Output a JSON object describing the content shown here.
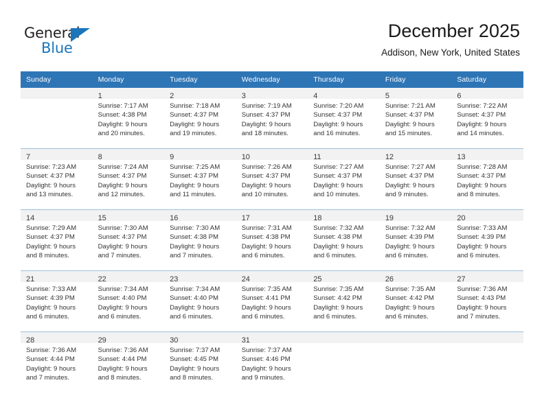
{
  "brand": {
    "name_part1": "General",
    "name_part2": "Blue",
    "accent_color": "#1b75bb"
  },
  "header": {
    "title": "December 2025",
    "subtitle": "Addison, New York, United States"
  },
  "theme": {
    "header_row_color": "#2e75b6",
    "daynum_band_color": "#f2f2f2",
    "row_separator_color": "#9dbfdc"
  },
  "calendar": {
    "weekday_headers": [
      "Sunday",
      "Monday",
      "Tuesday",
      "Wednesday",
      "Thursday",
      "Friday",
      "Saturday"
    ],
    "weeks": [
      [
        {
          "day": "",
          "lines": []
        },
        {
          "day": "1",
          "lines": [
            "Sunrise: 7:17 AM",
            "Sunset: 4:38 PM",
            "Daylight: 9 hours",
            "and 20 minutes."
          ]
        },
        {
          "day": "2",
          "lines": [
            "Sunrise: 7:18 AM",
            "Sunset: 4:37 PM",
            "Daylight: 9 hours",
            "and 19 minutes."
          ]
        },
        {
          "day": "3",
          "lines": [
            "Sunrise: 7:19 AM",
            "Sunset: 4:37 PM",
            "Daylight: 9 hours",
            "and 18 minutes."
          ]
        },
        {
          "day": "4",
          "lines": [
            "Sunrise: 7:20 AM",
            "Sunset: 4:37 PM",
            "Daylight: 9 hours",
            "and 16 minutes."
          ]
        },
        {
          "day": "5",
          "lines": [
            "Sunrise: 7:21 AM",
            "Sunset: 4:37 PM",
            "Daylight: 9 hours",
            "and 15 minutes."
          ]
        },
        {
          "day": "6",
          "lines": [
            "Sunrise: 7:22 AM",
            "Sunset: 4:37 PM",
            "Daylight: 9 hours",
            "and 14 minutes."
          ]
        }
      ],
      [
        {
          "day": "7",
          "lines": [
            "Sunrise: 7:23 AM",
            "Sunset: 4:37 PM",
            "Daylight: 9 hours",
            "and 13 minutes."
          ]
        },
        {
          "day": "8",
          "lines": [
            "Sunrise: 7:24 AM",
            "Sunset: 4:37 PM",
            "Daylight: 9 hours",
            "and 12 minutes."
          ]
        },
        {
          "day": "9",
          "lines": [
            "Sunrise: 7:25 AM",
            "Sunset: 4:37 PM",
            "Daylight: 9 hours",
            "and 11 minutes."
          ]
        },
        {
          "day": "10",
          "lines": [
            "Sunrise: 7:26 AM",
            "Sunset: 4:37 PM",
            "Daylight: 9 hours",
            "and 10 minutes."
          ]
        },
        {
          "day": "11",
          "lines": [
            "Sunrise: 7:27 AM",
            "Sunset: 4:37 PM",
            "Daylight: 9 hours",
            "and 10 minutes."
          ]
        },
        {
          "day": "12",
          "lines": [
            "Sunrise: 7:27 AM",
            "Sunset: 4:37 PM",
            "Daylight: 9 hours",
            "and 9 minutes."
          ]
        },
        {
          "day": "13",
          "lines": [
            "Sunrise: 7:28 AM",
            "Sunset: 4:37 PM",
            "Daylight: 9 hours",
            "and 8 minutes."
          ]
        }
      ],
      [
        {
          "day": "14",
          "lines": [
            "Sunrise: 7:29 AM",
            "Sunset: 4:37 PM",
            "Daylight: 9 hours",
            "and 8 minutes."
          ]
        },
        {
          "day": "15",
          "lines": [
            "Sunrise: 7:30 AM",
            "Sunset: 4:37 PM",
            "Daylight: 9 hours",
            "and 7 minutes."
          ]
        },
        {
          "day": "16",
          "lines": [
            "Sunrise: 7:30 AM",
            "Sunset: 4:38 PM",
            "Daylight: 9 hours",
            "and 7 minutes."
          ]
        },
        {
          "day": "17",
          "lines": [
            "Sunrise: 7:31 AM",
            "Sunset: 4:38 PM",
            "Daylight: 9 hours",
            "and 6 minutes."
          ]
        },
        {
          "day": "18",
          "lines": [
            "Sunrise: 7:32 AM",
            "Sunset: 4:38 PM",
            "Daylight: 9 hours",
            "and 6 minutes."
          ]
        },
        {
          "day": "19",
          "lines": [
            "Sunrise: 7:32 AM",
            "Sunset: 4:39 PM",
            "Daylight: 9 hours",
            "and 6 minutes."
          ]
        },
        {
          "day": "20",
          "lines": [
            "Sunrise: 7:33 AM",
            "Sunset: 4:39 PM",
            "Daylight: 9 hours",
            "and 6 minutes."
          ]
        }
      ],
      [
        {
          "day": "21",
          "lines": [
            "Sunrise: 7:33 AM",
            "Sunset: 4:39 PM",
            "Daylight: 9 hours",
            "and 6 minutes."
          ]
        },
        {
          "day": "22",
          "lines": [
            "Sunrise: 7:34 AM",
            "Sunset: 4:40 PM",
            "Daylight: 9 hours",
            "and 6 minutes."
          ]
        },
        {
          "day": "23",
          "lines": [
            "Sunrise: 7:34 AM",
            "Sunset: 4:40 PM",
            "Daylight: 9 hours",
            "and 6 minutes."
          ]
        },
        {
          "day": "24",
          "lines": [
            "Sunrise: 7:35 AM",
            "Sunset: 4:41 PM",
            "Daylight: 9 hours",
            "and 6 minutes."
          ]
        },
        {
          "day": "25",
          "lines": [
            "Sunrise: 7:35 AM",
            "Sunset: 4:42 PM",
            "Daylight: 9 hours",
            "and 6 minutes."
          ]
        },
        {
          "day": "26",
          "lines": [
            "Sunrise: 7:35 AM",
            "Sunset: 4:42 PM",
            "Daylight: 9 hours",
            "and 6 minutes."
          ]
        },
        {
          "day": "27",
          "lines": [
            "Sunrise: 7:36 AM",
            "Sunset: 4:43 PM",
            "Daylight: 9 hours",
            "and 7 minutes."
          ]
        }
      ],
      [
        {
          "day": "28",
          "lines": [
            "Sunrise: 7:36 AM",
            "Sunset: 4:44 PM",
            "Daylight: 9 hours",
            "and 7 minutes."
          ]
        },
        {
          "day": "29",
          "lines": [
            "Sunrise: 7:36 AM",
            "Sunset: 4:44 PM",
            "Daylight: 9 hours",
            "and 8 minutes."
          ]
        },
        {
          "day": "30",
          "lines": [
            "Sunrise: 7:37 AM",
            "Sunset: 4:45 PM",
            "Daylight: 9 hours",
            "and 8 minutes."
          ]
        },
        {
          "day": "31",
          "lines": [
            "Sunrise: 7:37 AM",
            "Sunset: 4:46 PM",
            "Daylight: 9 hours",
            "and 9 minutes."
          ]
        },
        {
          "day": "",
          "lines": []
        },
        {
          "day": "",
          "lines": []
        },
        {
          "day": "",
          "lines": []
        }
      ]
    ]
  }
}
